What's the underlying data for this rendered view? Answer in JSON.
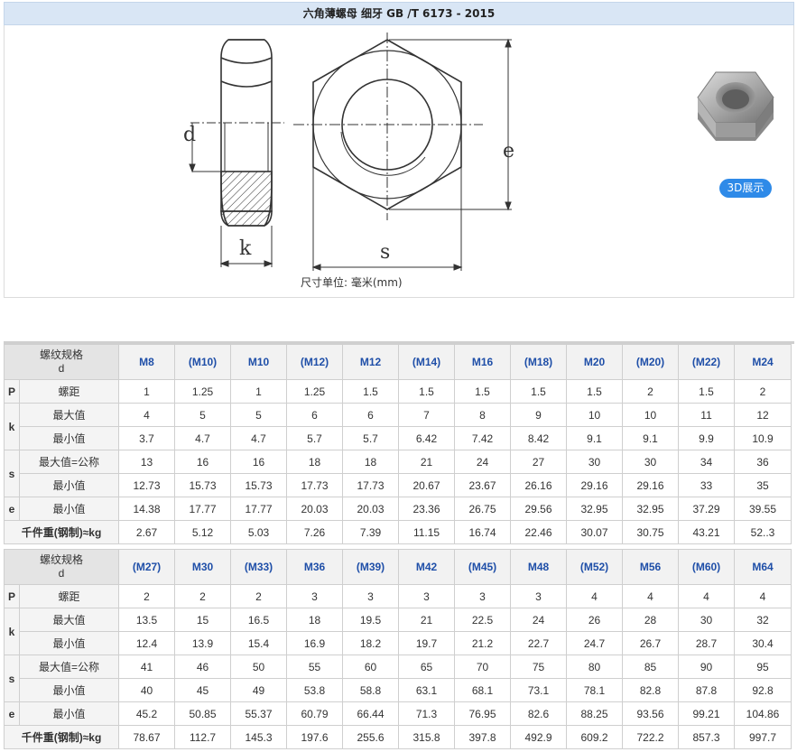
{
  "title": "六角薄螺母 细牙 GB /T 6173 - 2015",
  "figure": {
    "label_d": "d",
    "label_k": "k",
    "label_s": "s",
    "label_e": "e",
    "unit_label": "尺寸单位: 毫米(mm)",
    "btn_3d": "3D展示"
  },
  "row_labels": {
    "corner_line1": "螺纹规格",
    "corner_line2": "d",
    "P": "P",
    "k": "k",
    "s": "s",
    "e": "e",
    "pitch": "螺距",
    "max": "最大值",
    "min": "最小值",
    "max_nominal": "最大值=公称",
    "weight": "千件重(钢制)≈kg"
  },
  "tables": [
    {
      "sizes": [
        "M8",
        "(M10)",
        "M10",
        "(M12)",
        "M12",
        "(M14)",
        "M16",
        "(M18)",
        "M20",
        "(M20)",
        "(M22)",
        "M24"
      ],
      "pitch": [
        "1",
        "1.25",
        "1",
        "1.25",
        "1.5",
        "1.5",
        "1.5",
        "1.5",
        "1.5",
        "2",
        "1.5",
        "2"
      ],
      "k_max": [
        "4",
        "5",
        "5",
        "6",
        "6",
        "7",
        "8",
        "9",
        "10",
        "10",
        "11",
        "12"
      ],
      "k_min": [
        "3.7",
        "4.7",
        "4.7",
        "5.7",
        "5.7",
        "6.42",
        "7.42",
        "8.42",
        "9.1",
        "9.1",
        "9.9",
        "10.9"
      ],
      "s_max": [
        "13",
        "16",
        "16",
        "18",
        "18",
        "21",
        "24",
        "27",
        "30",
        "30",
        "34",
        "36"
      ],
      "s_min": [
        "12.73",
        "15.73",
        "15.73",
        "17.73",
        "17.73",
        "20.67",
        "23.67",
        "26.16",
        "29.16",
        "29.16",
        "33",
        "35"
      ],
      "e_min": [
        "14.38",
        "17.77",
        "17.77",
        "20.03",
        "20.03",
        "23.36",
        "26.75",
        "29.56",
        "32.95",
        "32.95",
        "37.29",
        "39.55"
      ],
      "weight": [
        "2.67",
        "5.12",
        "5.03",
        "7.26",
        "7.39",
        "11.15",
        "16.74",
        "22.46",
        "30.07",
        "30.75",
        "43.21",
        "52..3"
      ]
    },
    {
      "sizes": [
        "(M27)",
        "M30",
        "(M33)",
        "M36",
        "(M39)",
        "M42",
        "(M45)",
        "M48",
        "(M52)",
        "M56",
        "(M60)",
        "M64"
      ],
      "pitch": [
        "2",
        "2",
        "2",
        "3",
        "3",
        "3",
        "3",
        "3",
        "4",
        "4",
        "4",
        "4"
      ],
      "k_max": [
        "13.5",
        "15",
        "16.5",
        "18",
        "19.5",
        "21",
        "22.5",
        "24",
        "26",
        "28",
        "30",
        "32"
      ],
      "k_min": [
        "12.4",
        "13.9",
        "15.4",
        "16.9",
        "18.2",
        "19.7",
        "21.2",
        "22.7",
        "24.7",
        "26.7",
        "28.7",
        "30.4"
      ],
      "s_max": [
        "41",
        "46",
        "50",
        "55",
        "60",
        "65",
        "70",
        "75",
        "80",
        "85",
        "90",
        "95"
      ],
      "s_min": [
        "40",
        "45",
        "49",
        "53.8",
        "58.8",
        "63.1",
        "68.1",
        "73.1",
        "78.1",
        "82.8",
        "87.8",
        "92.8"
      ],
      "e_min": [
        "45.2",
        "50.85",
        "55.37",
        "60.79",
        "66.44",
        "71.3",
        "76.95",
        "82.6",
        "88.25",
        "93.56",
        "99.21",
        "104.86"
      ],
      "weight": [
        "78.67",
        "112.7",
        "145.3",
        "197.6",
        "255.6",
        "315.8",
        "397.8",
        "492.9",
        "609.2",
        "722.2",
        "857.3",
        "997.7"
      ]
    }
  ]
}
